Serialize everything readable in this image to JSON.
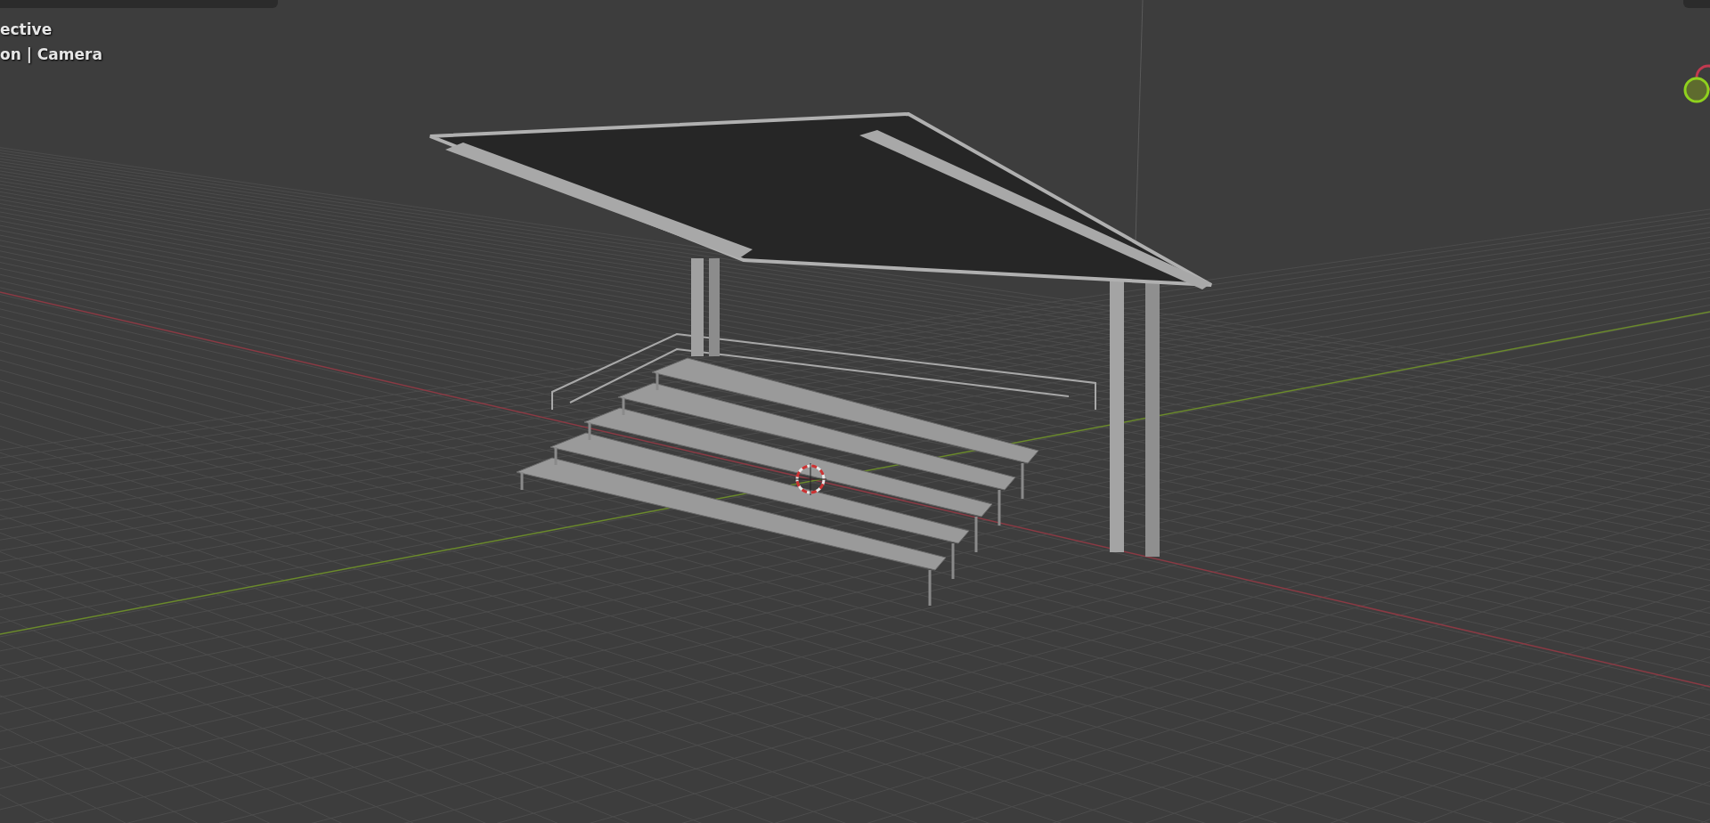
{
  "viewport": {
    "overlay_lines": [
      "ective",
      "on | Camera"
    ]
  }
}
